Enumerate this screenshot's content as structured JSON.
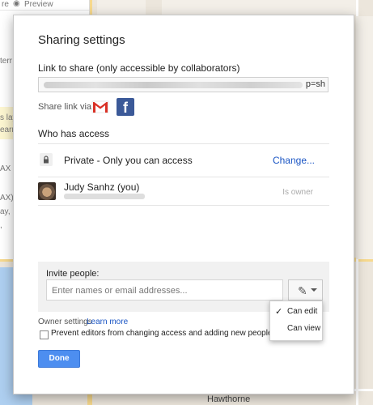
{
  "background": {
    "left_panel": {
      "top_left_fragment": "re",
      "preview_label": "Preview",
      "snippets": [
        "terr",
        "s lay",
        "earn",
        "AX",
        "AX),",
        "ay, L",
        ","
      ]
    },
    "map_label": "Hawthorne"
  },
  "dialog": {
    "title": "Sharing settings",
    "link_label": "Link to share (only accessible by collaborators)",
    "link_tail": "p=sh",
    "share_via_label": "Share link via:",
    "facebook_glyph": "f",
    "who_has_access": "Who has access",
    "access_text": "Private - Only you can access",
    "change_link": "Change...",
    "user_name": "Judy Sanhz (you)",
    "user_role": "Is owner",
    "invite_label": "Invite people:",
    "invite_placeholder": "Enter names or email addresses...",
    "owner_settings_label": "Owner settings",
    "learn_more": "Learn more",
    "checkbox_label": "Prevent editors from changing access and adding new people",
    "done_button": "Done",
    "permission_menu": {
      "items": [
        "Can edit",
        "Can view"
      ],
      "selected": "Can edit"
    }
  },
  "colors": {
    "accent": "#4d8ef0",
    "link": "#1a55c4",
    "facebook": "#3b5998",
    "gmail_red": "#d93025"
  }
}
